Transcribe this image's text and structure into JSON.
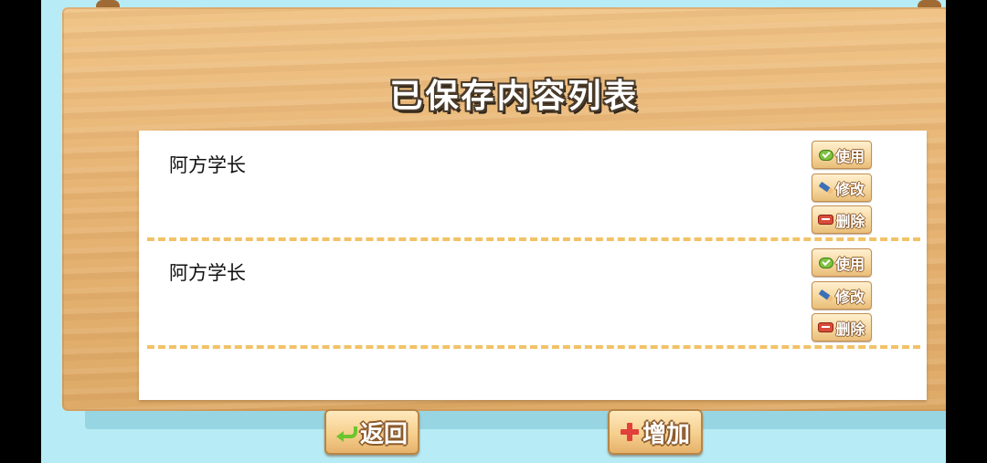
{
  "page": {
    "title": "已保存内容列表"
  },
  "entries": [
    {
      "name": "阿方学长",
      "use_label": "使用",
      "edit_label": "修改",
      "delete_label": "删除"
    },
    {
      "name": "阿方学长",
      "use_label": "使用",
      "edit_label": "修改",
      "delete_label": "删除"
    }
  ],
  "footer": {
    "back_label": "返回",
    "add_label": "增加"
  },
  "icons": {
    "use": "check-icon",
    "edit": "pencil-icon",
    "delete": "minus-icon",
    "back": "return-arrow-icon",
    "add": "plus-icon"
  },
  "colors": {
    "background": "#b7ecf6",
    "board": "#e7b474",
    "divider": "#f2c267",
    "button": "#f5cf8d"
  }
}
